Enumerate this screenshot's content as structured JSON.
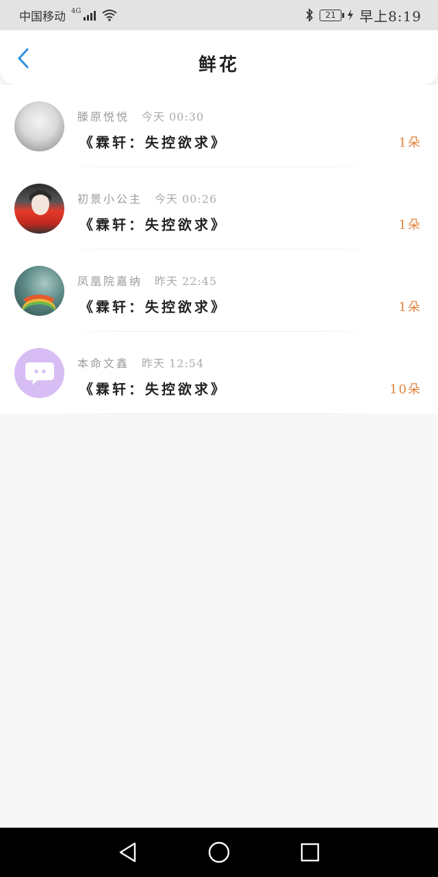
{
  "status_bar": {
    "carrier": "中国移动",
    "network": "4G",
    "battery": "21",
    "time": "早上8:19"
  },
  "header": {
    "title": "鲜花"
  },
  "items": [
    {
      "name": "滕原悦悦",
      "time": "今天 00:30",
      "book": "《霖轩：失控欲求》",
      "count": "1朵",
      "avatar": "avatar-frosted-branches"
    },
    {
      "name": "初景小公主",
      "time": "今天 00:26",
      "book": "《霖轩：失控欲求》",
      "count": "1朵",
      "avatar": "avatar-girl-red-scarf"
    },
    {
      "name": "凤凰院嘉纳",
      "time": "昨天 22:45",
      "book": "《霖轩：失控欲求》",
      "count": "1朵",
      "avatar": "avatar-rainbow"
    },
    {
      "name": "本命文鑫",
      "time": "昨天 12:54",
      "book": "《霖轩：失控欲求》",
      "count": "10朵",
      "avatar": "avatar-chat-bubble"
    }
  ],
  "colors": {
    "accent_blue": "#2f8ee0",
    "count_orange": "#e0823a",
    "avatar_purple": "#d7bdf4"
  },
  "icons": {
    "back": "chevron-left-icon",
    "nav_back": "triangle-back-icon",
    "nav_home": "circle-home-icon",
    "nav_recent": "square-recent-icon"
  }
}
